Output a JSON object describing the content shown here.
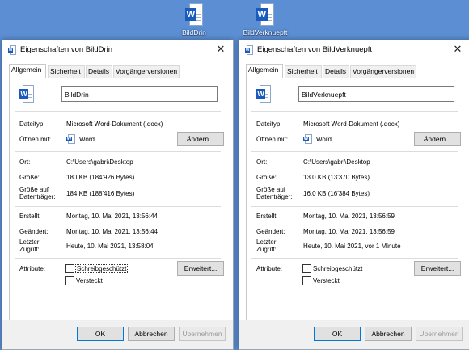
{
  "desktop": {
    "icons": [
      {
        "label": "BildDrin"
      },
      {
        "label": "BildVerknuepft"
      }
    ]
  },
  "dialogs": [
    {
      "title": "Eigenschaften von BildDrin",
      "tabs": [
        "Allgemein",
        "Sicherheit",
        "Details",
        "Vorgängerversionen"
      ],
      "filename": "BildDrin",
      "labels": {
        "dateityp": "Dateityp:",
        "oeffnen": "Öffnen mit:",
        "ort": "Ort:",
        "groesse": "Größe:",
        "groesse_auf": "Größe auf\nDatenträger:",
        "erstellt": "Erstellt:",
        "geaendert": "Geändert:",
        "zugriff": "Letzter\nZugriff:",
        "attribute": "Attribute:"
      },
      "values": {
        "dateityp": "Microsoft Word-Dokument (.docx)",
        "oeffnen": "Word",
        "ort": "C:\\Users\\gabri\\Desktop",
        "groesse": "180 KB (184'926 Bytes)",
        "groesse_auf": "184 KB (188'416 Bytes)",
        "erstellt": "Montag, 10. Mai 2021, 13:56:44",
        "geaendert": "Montag, 10. Mai 2021, 13:56:44",
        "zugriff": "Heute, 10. Mai 2021, 13:58:04"
      },
      "buttons": {
        "aendern": "Ändern...",
        "erweitert": "Erweitert...",
        "ok": "OK",
        "abbrechen": "Abbrechen",
        "uebernehmen": "Übernehmen"
      },
      "checkboxes": {
        "schreibgeschuetzt": "Schreibgeschützt",
        "versteckt": "Versteckt"
      }
    },
    {
      "title": "Eigenschaften von BildVerknuepft",
      "tabs": [
        "Allgemein",
        "Sicherheit",
        "Details",
        "Vorgängerversionen"
      ],
      "filename": "BildVerknuepft",
      "labels": {
        "dateityp": "Dateityp:",
        "oeffnen": "Öffnen mit:",
        "ort": "Ort:",
        "groesse": "Größe:",
        "groesse_auf": "Größe auf\nDatenträger:",
        "erstellt": "Erstellt:",
        "geaendert": "Geändert:",
        "zugriff": "Letzter\nZugriff:",
        "attribute": "Attribute:"
      },
      "values": {
        "dateityp": "Microsoft Word-Dokument (.docx)",
        "oeffnen": "Word",
        "ort": "C:\\Users\\gabri\\Desktop",
        "groesse": "13.0 KB (13'370 Bytes)",
        "groesse_auf": "16.0 KB (16'384 Bytes)",
        "erstellt": "Montag, 10. Mai 2021, 13:56:59",
        "geaendert": "Montag, 10. Mai 2021, 13:56:59",
        "zugriff": "Heute, 10. Mai 2021, vor 1 Minute"
      },
      "buttons": {
        "aendern": "Ändern...",
        "erweitert": "Erweitert...",
        "ok": "OK",
        "abbrechen": "Abbrechen",
        "uebernehmen": "Übernehmen"
      },
      "checkboxes": {
        "schreibgeschuetzt": "Schreibgeschützt",
        "versteckt": "Versteckt"
      }
    }
  ],
  "icon_names": {
    "word_file": "word-document-icon",
    "close": "close-icon"
  },
  "colors": {
    "desktop": "#5b8ed2",
    "word_blue": "#185abd",
    "focus": "#0078d7"
  }
}
